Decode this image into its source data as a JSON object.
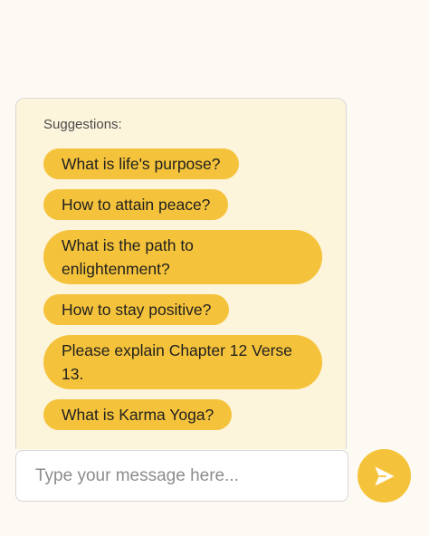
{
  "suggestions": {
    "label": "Suggestions:",
    "items": [
      {
        "label": "What is life's purpose?"
      },
      {
        "label": "How to attain peace?"
      },
      {
        "label": "What is the path to enlightenment?"
      },
      {
        "label": "How to stay positive?"
      },
      {
        "label": "Please explain Chapter 12 Verse 13."
      },
      {
        "label": "What is Karma Yoga?"
      }
    ]
  },
  "composer": {
    "placeholder": "Type your message here...",
    "value": "",
    "send_icon": "send-icon"
  },
  "colors": {
    "accent": "#f5c33b",
    "panel_background": "#fdf4dc",
    "page_background": "#fdfaf3"
  }
}
